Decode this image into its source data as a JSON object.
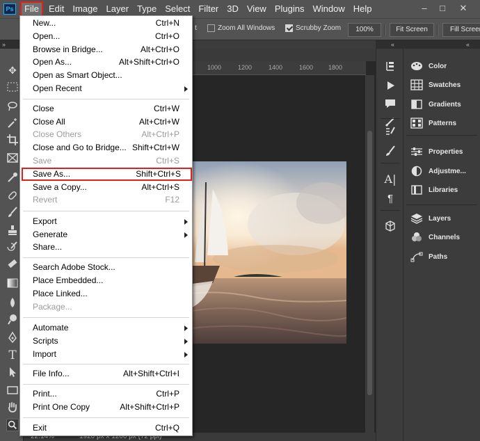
{
  "menubar": {
    "logo": "Ps",
    "items": [
      "File",
      "Edit",
      "Image",
      "Layer",
      "Type",
      "Select",
      "Filter",
      "3D",
      "View",
      "Plugins",
      "Window",
      "Help"
    ],
    "window_controls": [
      "–",
      "□",
      "✕"
    ]
  },
  "options_bar": {
    "zoom_all_windows": "Zoom All Windows",
    "scrubby_zoom": "Scrubby Zoom",
    "zoom_percent": "100%",
    "fit_screen": "Fit Screen",
    "fill_screen": "Fill Screen",
    "partial_checkbox_label": "t"
  },
  "document": {
    "ruler_ticks": [
      "1000",
      "1200",
      "1400",
      "1600",
      "1800"
    ],
    "status_zoom": "22.14%",
    "status_info": "1920 px x 1200 px (72 ppi)"
  },
  "file_menu": {
    "items": [
      {
        "label": "New...",
        "shortcut": "Ctrl+N",
        "disabled": false
      },
      {
        "label": "Open...",
        "shortcut": "Ctrl+O",
        "disabled": false
      },
      {
        "label": "Browse in Bridge...",
        "shortcut": "Alt+Ctrl+O",
        "disabled": false
      },
      {
        "label": "Open As...",
        "shortcut": "Alt+Shift+Ctrl+O",
        "disabled": false
      },
      {
        "label": "Open as Smart Object...",
        "shortcut": "",
        "disabled": false
      },
      {
        "label": "Open Recent",
        "shortcut": "",
        "disabled": false,
        "submenu": true
      },
      {
        "label": "Close",
        "shortcut": "Ctrl+W",
        "disabled": false
      },
      {
        "label": "Close All",
        "shortcut": "Alt+Ctrl+W",
        "disabled": false
      },
      {
        "label": "Close Others",
        "shortcut": "Alt+Ctrl+P",
        "disabled": true
      },
      {
        "label": "Close and Go to Bridge...",
        "shortcut": "Shift+Ctrl+W",
        "disabled": false
      },
      {
        "label": "Save",
        "shortcut": "Ctrl+S",
        "disabled": true
      },
      {
        "label": "Save As...",
        "shortcut": "Shift+Ctrl+S",
        "disabled": false,
        "highlighted": true
      },
      {
        "label": "Save a Copy...",
        "shortcut": "Alt+Ctrl+S",
        "disabled": false
      },
      {
        "label": "Revert",
        "shortcut": "F12",
        "disabled": true
      },
      {
        "label": "Export",
        "shortcut": "",
        "disabled": false,
        "submenu": true
      },
      {
        "label": "Generate",
        "shortcut": "",
        "disabled": false,
        "submenu": true
      },
      {
        "label": "Share...",
        "shortcut": "",
        "disabled": false
      },
      {
        "label": "Search Adobe Stock...",
        "shortcut": "",
        "disabled": false
      },
      {
        "label": "Place Embedded...",
        "shortcut": "",
        "disabled": false
      },
      {
        "label": "Place Linked...",
        "shortcut": "",
        "disabled": false
      },
      {
        "label": "Package...",
        "shortcut": "",
        "disabled": true
      },
      {
        "label": "Automate",
        "shortcut": "",
        "disabled": false,
        "submenu": true
      },
      {
        "label": "Scripts",
        "shortcut": "",
        "disabled": false,
        "submenu": true
      },
      {
        "label": "Import",
        "shortcut": "",
        "disabled": false,
        "submenu": true
      },
      {
        "label": "File Info...",
        "shortcut": "Alt+Shift+Ctrl+I",
        "disabled": false
      },
      {
        "label": "Print...",
        "shortcut": "Ctrl+P",
        "disabled": false
      },
      {
        "label": "Print One Copy",
        "shortcut": "Alt+Shift+Ctrl+P",
        "disabled": false
      },
      {
        "label": "Exit",
        "shortcut": "Ctrl+Q",
        "disabled": false
      }
    ]
  },
  "right_panels": {
    "group1": [
      "Color",
      "Swatches",
      "Gradients",
      "Patterns"
    ],
    "group2": [
      "Properties",
      "Adjustme...",
      "Libraries"
    ],
    "group3": [
      "Layers",
      "Channels",
      "Paths"
    ]
  },
  "colors": {
    "highlight_outline": "#e0201c",
    "ui_dark": "#535353",
    "canvas_bg": "#282828"
  }
}
